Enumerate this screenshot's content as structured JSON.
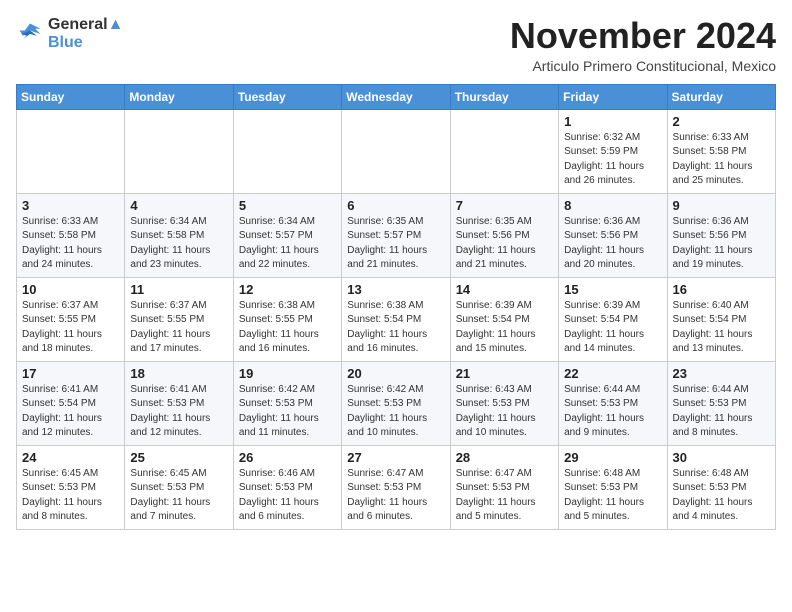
{
  "logo": {
    "line1": "General",
    "line2": "Blue"
  },
  "header": {
    "month": "November 2024",
    "location": "Articulo Primero Constitucional, Mexico"
  },
  "weekdays": [
    "Sunday",
    "Monday",
    "Tuesday",
    "Wednesday",
    "Thursday",
    "Friday",
    "Saturday"
  ],
  "weeks": [
    [
      {
        "day": "",
        "info": ""
      },
      {
        "day": "",
        "info": ""
      },
      {
        "day": "",
        "info": ""
      },
      {
        "day": "",
        "info": ""
      },
      {
        "day": "",
        "info": ""
      },
      {
        "day": "1",
        "info": "Sunrise: 6:32 AM\nSunset: 5:59 PM\nDaylight: 11 hours\nand 26 minutes."
      },
      {
        "day": "2",
        "info": "Sunrise: 6:33 AM\nSunset: 5:58 PM\nDaylight: 11 hours\nand 25 minutes."
      }
    ],
    [
      {
        "day": "3",
        "info": "Sunrise: 6:33 AM\nSunset: 5:58 PM\nDaylight: 11 hours\nand 24 minutes."
      },
      {
        "day": "4",
        "info": "Sunrise: 6:34 AM\nSunset: 5:58 PM\nDaylight: 11 hours\nand 23 minutes."
      },
      {
        "day": "5",
        "info": "Sunrise: 6:34 AM\nSunset: 5:57 PM\nDaylight: 11 hours\nand 22 minutes."
      },
      {
        "day": "6",
        "info": "Sunrise: 6:35 AM\nSunset: 5:57 PM\nDaylight: 11 hours\nand 21 minutes."
      },
      {
        "day": "7",
        "info": "Sunrise: 6:35 AM\nSunset: 5:56 PM\nDaylight: 11 hours\nand 21 minutes."
      },
      {
        "day": "8",
        "info": "Sunrise: 6:36 AM\nSunset: 5:56 PM\nDaylight: 11 hours\nand 20 minutes."
      },
      {
        "day": "9",
        "info": "Sunrise: 6:36 AM\nSunset: 5:56 PM\nDaylight: 11 hours\nand 19 minutes."
      }
    ],
    [
      {
        "day": "10",
        "info": "Sunrise: 6:37 AM\nSunset: 5:55 PM\nDaylight: 11 hours\nand 18 minutes."
      },
      {
        "day": "11",
        "info": "Sunrise: 6:37 AM\nSunset: 5:55 PM\nDaylight: 11 hours\nand 17 minutes."
      },
      {
        "day": "12",
        "info": "Sunrise: 6:38 AM\nSunset: 5:55 PM\nDaylight: 11 hours\nand 16 minutes."
      },
      {
        "day": "13",
        "info": "Sunrise: 6:38 AM\nSunset: 5:54 PM\nDaylight: 11 hours\nand 16 minutes."
      },
      {
        "day": "14",
        "info": "Sunrise: 6:39 AM\nSunset: 5:54 PM\nDaylight: 11 hours\nand 15 minutes."
      },
      {
        "day": "15",
        "info": "Sunrise: 6:39 AM\nSunset: 5:54 PM\nDaylight: 11 hours\nand 14 minutes."
      },
      {
        "day": "16",
        "info": "Sunrise: 6:40 AM\nSunset: 5:54 PM\nDaylight: 11 hours\nand 13 minutes."
      }
    ],
    [
      {
        "day": "17",
        "info": "Sunrise: 6:41 AM\nSunset: 5:54 PM\nDaylight: 11 hours\nand 12 minutes."
      },
      {
        "day": "18",
        "info": "Sunrise: 6:41 AM\nSunset: 5:53 PM\nDaylight: 11 hours\nand 12 minutes."
      },
      {
        "day": "19",
        "info": "Sunrise: 6:42 AM\nSunset: 5:53 PM\nDaylight: 11 hours\nand 11 minutes."
      },
      {
        "day": "20",
        "info": "Sunrise: 6:42 AM\nSunset: 5:53 PM\nDaylight: 11 hours\nand 10 minutes."
      },
      {
        "day": "21",
        "info": "Sunrise: 6:43 AM\nSunset: 5:53 PM\nDaylight: 11 hours\nand 10 minutes."
      },
      {
        "day": "22",
        "info": "Sunrise: 6:44 AM\nSunset: 5:53 PM\nDaylight: 11 hours\nand 9 minutes."
      },
      {
        "day": "23",
        "info": "Sunrise: 6:44 AM\nSunset: 5:53 PM\nDaylight: 11 hours\nand 8 minutes."
      }
    ],
    [
      {
        "day": "24",
        "info": "Sunrise: 6:45 AM\nSunset: 5:53 PM\nDaylight: 11 hours\nand 8 minutes."
      },
      {
        "day": "25",
        "info": "Sunrise: 6:45 AM\nSunset: 5:53 PM\nDaylight: 11 hours\nand 7 minutes."
      },
      {
        "day": "26",
        "info": "Sunrise: 6:46 AM\nSunset: 5:53 PM\nDaylight: 11 hours\nand 6 minutes."
      },
      {
        "day": "27",
        "info": "Sunrise: 6:47 AM\nSunset: 5:53 PM\nDaylight: 11 hours\nand 6 minutes."
      },
      {
        "day": "28",
        "info": "Sunrise: 6:47 AM\nSunset: 5:53 PM\nDaylight: 11 hours\nand 5 minutes."
      },
      {
        "day": "29",
        "info": "Sunrise: 6:48 AM\nSunset: 5:53 PM\nDaylight: 11 hours\nand 5 minutes."
      },
      {
        "day": "30",
        "info": "Sunrise: 6:48 AM\nSunset: 5:53 PM\nDaylight: 11 hours\nand 4 minutes."
      }
    ]
  ]
}
